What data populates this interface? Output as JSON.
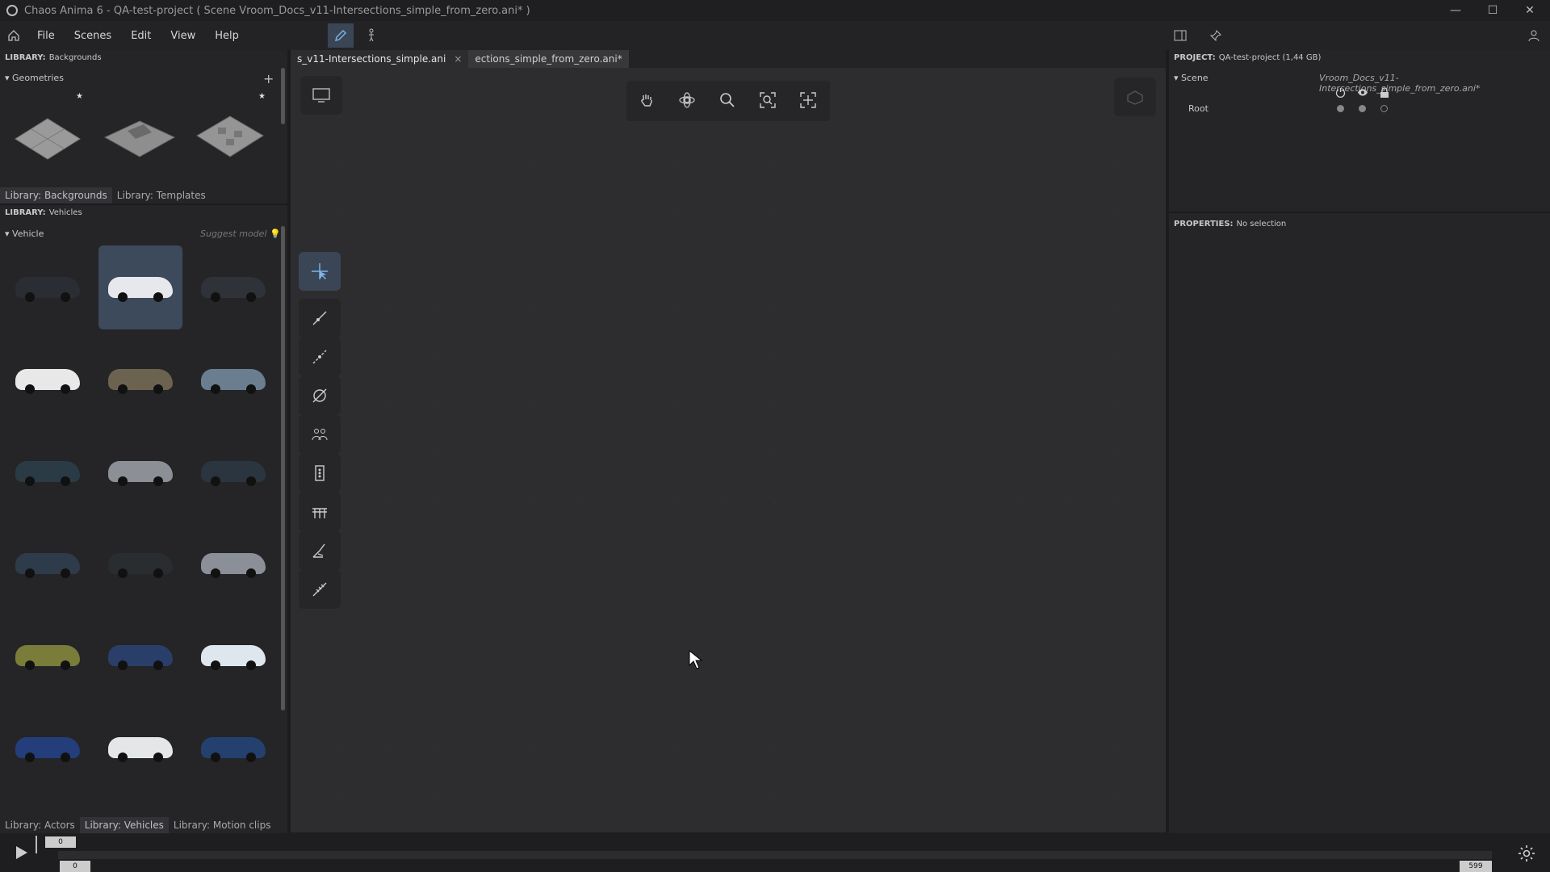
{
  "window": {
    "title": "Chaos Anima 6 -   QA-test-project ( Scene Vroom_Docs_v11-Intersections_simple_from_zero.ani* )",
    "minimize": "—",
    "maximize": "☐",
    "close": "✕"
  },
  "menubar": {
    "items": [
      "File",
      "Scenes",
      "Edit",
      "View",
      "Help"
    ]
  },
  "library_top": {
    "label": "LIBRARY:",
    "value": "Backgrounds",
    "section": "Geometries",
    "tabs": [
      "Library: Backgrounds",
      "Library: Templates"
    ]
  },
  "library_vehicles": {
    "label": "LIBRARY:",
    "value": "Vehicles",
    "section": "Vehicle",
    "suggest": "Suggest model",
    "tabs": [
      "Library: Actors",
      "Library: Vehicles",
      "Library: Motion clips"
    ],
    "cars": [
      {
        "color": "#2a2d33"
      },
      {
        "color": "#e6e8ec"
      },
      {
        "color": "#2f3238"
      },
      {
        "color": "#e8e8e8"
      },
      {
        "color": "#6b6250"
      },
      {
        "color": "#6a7e90"
      },
      {
        "color": "#2b3b45"
      },
      {
        "color": "#8c9096"
      },
      {
        "color": "#2a3540"
      },
      {
        "color": "#2e3b4a"
      },
      {
        "color": "#2a2d30"
      },
      {
        "color": "#8a8f98"
      },
      {
        "color": "#7a7c3a"
      },
      {
        "color": "#2a3e6a"
      },
      {
        "color": "#dfe7ee"
      },
      {
        "color": "#233e7a"
      },
      {
        "color": "#e4e6e8"
      },
      {
        "color": "#24406e"
      }
    ]
  },
  "doc_tabs": [
    {
      "label": "s_v11-Intersections_simple.ani",
      "close": "×"
    },
    {
      "label": "ections_simple_from_zero.ani*"
    }
  ],
  "project": {
    "label": "PROJECT:",
    "value": "QA-test-project (1,44 GB)",
    "scene_label": "Scene",
    "scene_file": "Vroom_Docs_v11-Intersections_simple_from_zero.ani*",
    "root": "Root"
  },
  "properties": {
    "label": "PROPERTIES:",
    "value": "No selection"
  },
  "timeline": {
    "current": "0",
    "start": "0",
    "end": "599"
  }
}
